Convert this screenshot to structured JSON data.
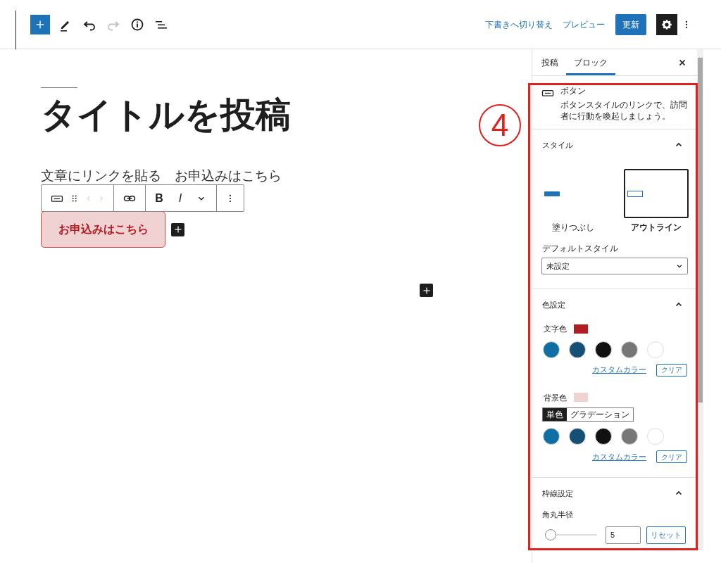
{
  "toolbar": {
    "left": [
      {
        "kind": "add",
        "disabled": false
      },
      {
        "kind": "pencil",
        "disabled": false
      },
      {
        "kind": "undo",
        "disabled": false
      },
      {
        "kind": "redo",
        "disabled": true
      },
      {
        "kind": "info",
        "disabled": false
      },
      {
        "kind": "list",
        "disabled": false
      }
    ],
    "switch_to_draft": "下書きへ切り替え",
    "preview": "プレビュー",
    "update": "更新"
  },
  "editor": {
    "title": "タイトルを投稿",
    "paragraph": "文章にリンクを貼る　お申込みはこちら",
    "block_toolbar": {
      "bold": "B",
      "italic": "I"
    },
    "button": {
      "label": "お申込みはこちら"
    }
  },
  "sidebar": {
    "tabs": [
      {
        "label": "投稿",
        "selected": false
      },
      {
        "label": "ブロック",
        "selected": true
      }
    ],
    "block": {
      "name": "ボタン",
      "description": "ボタンスタイルのリンクで、訪問者に行動を喚起しましょう。"
    },
    "style": {
      "heading": "スタイル",
      "expanded": true,
      "options": [
        {
          "kind": "fill",
          "label": "塗りつぶし",
          "selected": false
        },
        {
          "kind": "outline",
          "label": "アウトライン",
          "selected": true
        }
      ],
      "default_label": "デフォルトスタイル",
      "default_value": "未設定"
    },
    "color": {
      "heading": "色設定",
      "expanded": true,
      "text_color": {
        "label": "文字色",
        "color": "#b01e24",
        "palette": [
          {
            "color": "#0f6ea3"
          },
          {
            "color": "#164f76"
          },
          {
            "color": "#111111"
          },
          {
            "color": "#777777"
          },
          {
            "color": "#ffffff"
          }
        ],
        "custom": "カスタムカラー",
        "clear": "クリア"
      },
      "background_color": {
        "label": "背景色",
        "color": "#f0d2d2",
        "modes": [
          {
            "label": "単色",
            "selected": true
          },
          {
            "label": "グラデーション",
            "selected": false
          }
        ],
        "palette": [
          {
            "color": "#0f6ea3"
          },
          {
            "color": "#164f76"
          },
          {
            "color": "#111111"
          },
          {
            "color": "#777777"
          },
          {
            "color": "#ffffff"
          }
        ],
        "custom": "カスタムカラー",
        "clear": "クリア"
      }
    },
    "border": {
      "heading": "枠線設定",
      "expanded": true,
      "radius_label": "角丸半径",
      "level": 0,
      "value": "5",
      "reset": "リセット"
    }
  },
  "annotation": {
    "number": "4"
  }
}
